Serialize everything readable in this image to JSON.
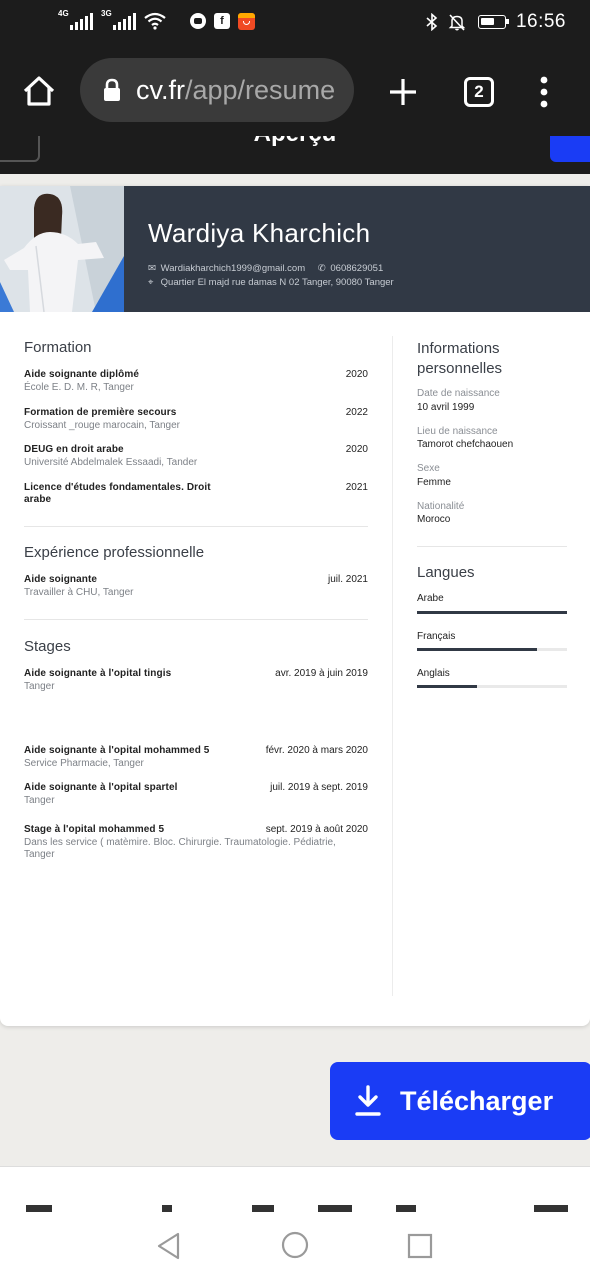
{
  "status_bar": {
    "network_1": "4G",
    "network_2": "3G",
    "time": "16:56"
  },
  "browser": {
    "url_domain": "cv.fr",
    "url_path": "/app/resume",
    "tab_count": "2"
  },
  "page": {
    "title": "Aperçu"
  },
  "cv": {
    "name": "Wardiya Kharchich",
    "email": "Wardiakharchich1999@gmail.com",
    "phone": "0608629051",
    "address": "Quartier El majd rue damas N 02 Tanger, 90080 Tanger",
    "sections": {
      "formation": "Formation",
      "experience": "Expérience professionnelle",
      "stages": "Stages",
      "personal": "Informations personnelles",
      "languages": "Langues"
    },
    "formation": [
      {
        "title": "Aide soignante diplômé",
        "date": "2020",
        "sub": "École E. D. M. R, Tanger"
      },
      {
        "title": "Formation de première secours",
        "date": "2022",
        "sub": "Croissant _rouge marocain, Tanger"
      },
      {
        "title": "DEUG en droit arabe",
        "date": "2020",
        "sub": "Université Abdelmalek Essaadi, Tander"
      },
      {
        "title": "Licence d'études fondamentales. Droit arabe",
        "date": "2021",
        "sub": ""
      }
    ],
    "experience": [
      {
        "title": "Aide soignante",
        "date": "juil. 2021",
        "sub": "Travailler à CHU, Tanger"
      }
    ],
    "stages": [
      {
        "title": "Aide soignante à l'opital tingis",
        "date": "avr. 2019 à juin 2019",
        "sub": "Tanger"
      },
      {
        "title": "Aide soignante à l'opital mohammed 5",
        "date": "févr. 2020 à mars 2020",
        "sub": "Service Pharmacie, Tanger"
      },
      {
        "title": "Aide soignante à l'opital spartel",
        "date": "juil. 2019 à sept. 2019",
        "sub": "Tanger"
      },
      {
        "title": "Stage à l'opital mohammed 5",
        "date": "sept. 2019 à août 2020",
        "sub": "Dans les service ( matèmire. Bloc. Chirurgie. Traumatologie. Pédiatrie, Tanger"
      }
    ],
    "personal": [
      {
        "label": "Date de naissance",
        "value": "10 avril 1999"
      },
      {
        "label": "Lieu de naissance",
        "value": "Tamorot chefchaouen"
      },
      {
        "label": "Sexe",
        "value": "Femme"
      },
      {
        "label": "Nationalité",
        "value": "Moroco"
      }
    ],
    "languages": [
      {
        "name": "Arabe",
        "level": 1.0
      },
      {
        "name": "Français",
        "level": 0.8
      },
      {
        "name": "Anglais",
        "level": 0.4
      }
    ]
  },
  "download": {
    "label": "Télécharger"
  },
  "colors": {
    "accent": "#1a3cf5",
    "header_bg": "#313945"
  }
}
